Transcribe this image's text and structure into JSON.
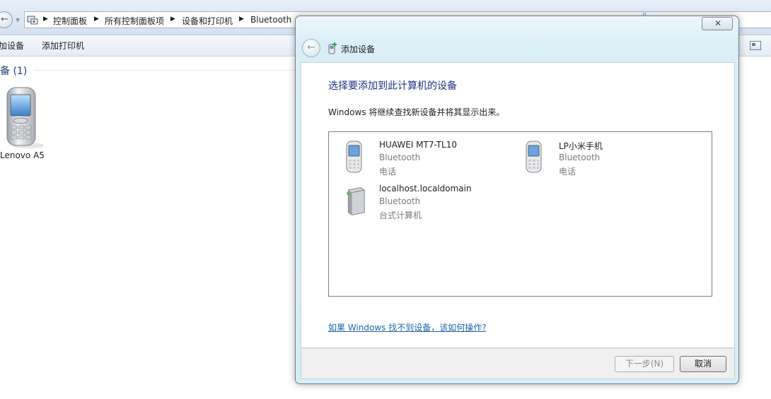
{
  "explorer": {
    "breadcrumbs": [
      "控制面板",
      "所有控制面板项",
      "设备和打印机",
      "Bluetooth"
    ],
    "commands": [
      "加设备",
      "添加打印机"
    ],
    "group_header": "备 (1)",
    "device_label": "Lenovo A5"
  },
  "dialog": {
    "title": "添加设备",
    "instruction": "选择要添加到此计算机的设备",
    "subtext": "Windows 将继续查找新设备并将其显示出来。",
    "devices": [
      {
        "name": "HUAWEI MT7-TL10",
        "type": "Bluetooth",
        "category": "电话",
        "icon": "phone-icon"
      },
      {
        "name": "LP小米手机",
        "type": "Bluetooth",
        "category": "电话",
        "icon": "phone-icon"
      },
      {
        "name": "localhost.localdomain",
        "type": "Bluetooth",
        "category": "台式计算机",
        "icon": "desktop-computer-icon"
      }
    ],
    "help_link": "如果 Windows 找不到设备，该如何操作?",
    "next_label": "下一步(N)",
    "cancel_label": "取消"
  },
  "colors": {
    "instruction": "#1e3287",
    "link": "#1e66aa",
    "dialog_frame": "#d7edf6"
  }
}
